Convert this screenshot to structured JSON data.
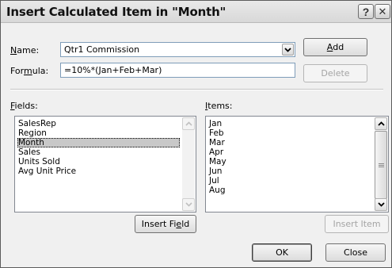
{
  "dialog": {
    "title": "Insert Calculated Item in \"Month\""
  },
  "titlebar": {
    "help_label": "?",
    "close_label": "✕"
  },
  "name_field": {
    "label_prefix": "",
    "label_accel": "N",
    "label_rest": "ame:",
    "value": "Qtr1 Commission"
  },
  "formula_field": {
    "label_prefix": "For",
    "label_accel": "m",
    "label_rest": "ula:",
    "value": "=10%*(Jan+Feb+Mar)"
  },
  "buttons": {
    "add": {
      "prefix": "",
      "accel": "A",
      "rest": "dd"
    },
    "delete": "Delete",
    "insert_field": {
      "prefix": "Insert Fi",
      "accel": "e",
      "rest": "ld"
    },
    "insert_item": "Insert Item",
    "ok": "OK",
    "close": "Close"
  },
  "fields": {
    "label_accel": "F",
    "label_rest": "ields:",
    "items": [
      "SalesRep",
      "Region",
      "Month",
      "Sales",
      "Units Sold",
      "Avg Unit Price"
    ],
    "selected": "Month"
  },
  "items": {
    "label_accel": "I",
    "label_rest": "tems:",
    "items": [
      "Jan",
      "Feb",
      "Mar",
      "Apr",
      "May",
      "Jun",
      "Jul",
      "Aug"
    ]
  },
  "colors": {
    "dialog_bg": "#f0f0f0",
    "selection": "#c8c8c8",
    "disabled_text": "#a4a4a4"
  }
}
